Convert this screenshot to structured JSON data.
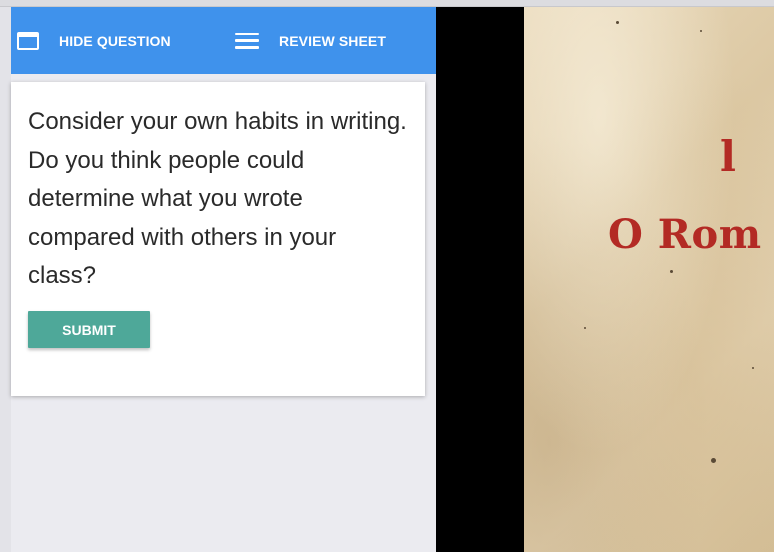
{
  "toolbar": {
    "hide_question_label": "HIDE QUESTION",
    "review_sheet_label": "REVIEW SHEET",
    "background_color": "#3f92ec",
    "icons": [
      "window-icon",
      "menu-icon"
    ]
  },
  "question_card": {
    "text": "Consider your own habits in writing. Do you think people could determine what you wrote compared with others in your class?",
    "submit_label": "SUBMIT",
    "submit_color": "#4ea899"
  },
  "manuscript": {
    "number": "l",
    "title": "O Rom",
    "ink_color": "#b32a24"
  }
}
